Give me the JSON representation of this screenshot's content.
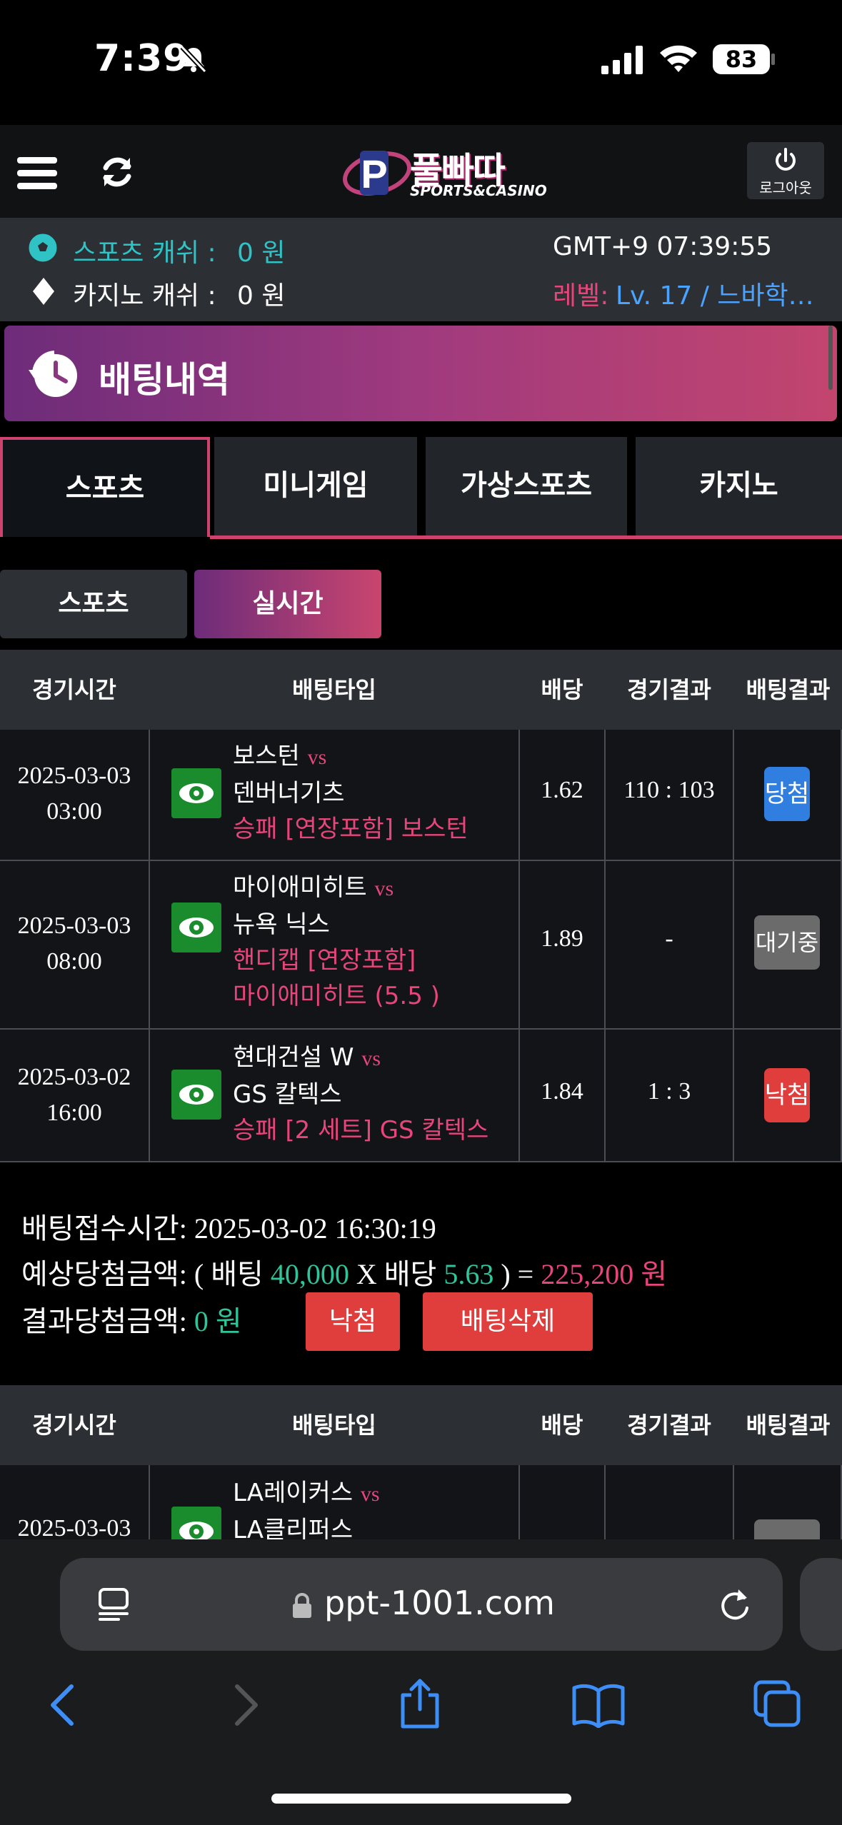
{
  "status_bar": {
    "time": "7:39",
    "battery": "83"
  },
  "header": {
    "logo_text": "풀빠따",
    "logo_sub": "SPORTS&CASINO",
    "logout_label": "로그아웃"
  },
  "info": {
    "sports_cash_label": "스포츠 캐쉬 :",
    "sports_cash_value": "0 원",
    "casino_cash_label": "카지노 캐쉬 :",
    "casino_cash_value": "0 원",
    "clock": "GMT+9 07:39:55",
    "level_label": "레벨:",
    "level_value": "Lv. 17 / 느바학…"
  },
  "banner": {
    "title": "배팅내역"
  },
  "tabs": [
    {
      "label": "스포츠",
      "active": true
    },
    {
      "label": "미니게임",
      "active": false
    },
    {
      "label": "가상스포츠",
      "active": false
    },
    {
      "label": "카지노",
      "active": false
    }
  ],
  "subtabs": [
    {
      "label": "스포츠",
      "active": false
    },
    {
      "label": "실시간",
      "active": true
    }
  ],
  "table_headers": [
    "경기시간",
    "배팅타입",
    "배당",
    "경기결과",
    "배팅결과"
  ],
  "bets": [
    {
      "date": "2025-03-03",
      "time": "03:00",
      "home": "보스턴",
      "vs": "vs",
      "away": "덴버너기츠",
      "pick_line1": "승패 [연장포함] 보스턴",
      "pick_line2": "",
      "odds": "1.62",
      "score": "110 : 103",
      "result": "당첨"
    },
    {
      "date": "2025-03-03",
      "time": "08:00",
      "home": "마이애미히트",
      "vs": "vs",
      "away": "뉴욕 닉스",
      "pick_line1": "핸디캡 [연장포함]",
      "pick_line2": "마이애미히트 (5.5 )",
      "odds": "1.89",
      "score": "-",
      "result": "대기중"
    },
    {
      "date": "2025-03-02",
      "time": "16:00",
      "home": "현대건설 W",
      "vs": "vs",
      "away": "GS 칼텍스",
      "pick_line1": "승패 [2 세트] GS 칼텍스",
      "pick_line2": "",
      "odds": "1.84",
      "score": "1 : 3",
      "result": "낙첨"
    }
  ],
  "summary": {
    "accepted_label": "배팅접수시간:",
    "accepted_value": "2025-03-02 16:30:19",
    "expected_label": "예상당첨금액:",
    "expected_open": "( 배팅",
    "bet_amount": "40,000",
    "x_label": "X 배당",
    "total_odds": "5.63",
    "expected_close": ") =",
    "expected_amount": "225,200 원",
    "result_label": "결과당첨금액:",
    "result_amount": "0 원",
    "status_button": "낙첨",
    "delete_button": "배팅삭제"
  },
  "next_bet": {
    "date": "2025-03-03",
    "home": "LA레이커스",
    "vs": "vs",
    "away": "LA클리퍼스"
  },
  "browser": {
    "url": "ppt-1001.com"
  }
}
